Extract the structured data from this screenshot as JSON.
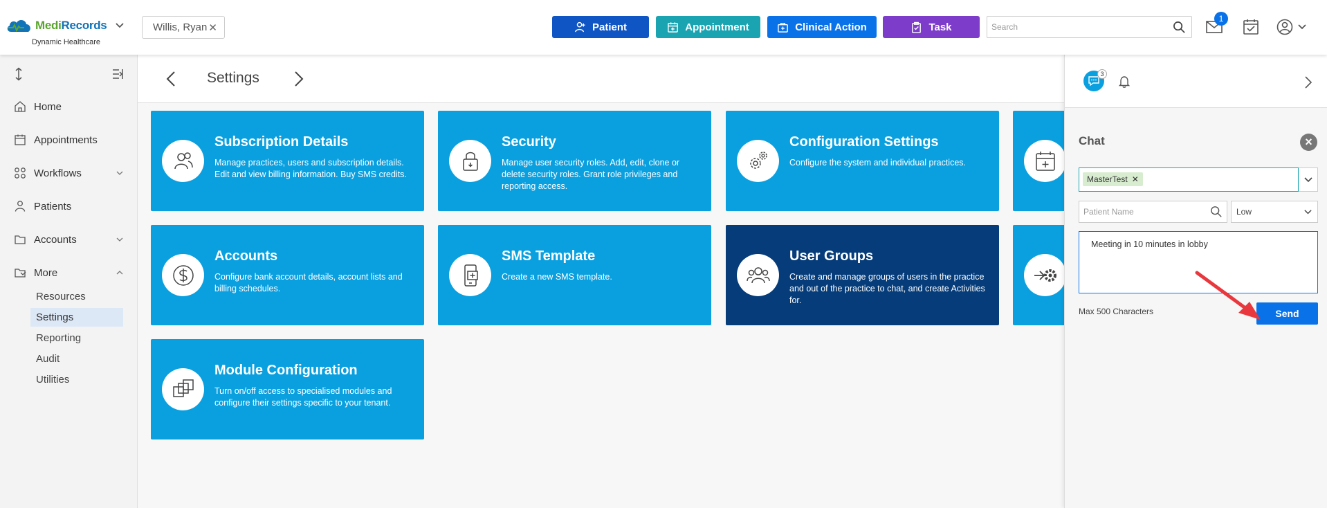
{
  "brand": {
    "name_part1": "Medi",
    "name_part2": "Records",
    "subtitle": "Dynamic Healthcare"
  },
  "header": {
    "patient_chip": "Willis, Ryan",
    "buttons": {
      "patient": "Patient",
      "appointment": "Appointment",
      "clinical_action": "Clinical Action",
      "task": "Task"
    },
    "button_colors": {
      "patient": "#0f56c4",
      "appointment": "#1aa4b2",
      "clinical_action": "#0a72e8",
      "task": "#7d3cc9"
    },
    "search_placeholder": "Search",
    "mail_badge": "1"
  },
  "sidebar": {
    "items": [
      {
        "label": "Home",
        "icon": "home-icon"
      },
      {
        "label": "Appointments",
        "icon": "calendar-icon"
      },
      {
        "label": "Workflows",
        "icon": "workflow-icon"
      },
      {
        "label": "Patients",
        "icon": "person-icon"
      },
      {
        "label": "Accounts",
        "icon": "folder-icon"
      },
      {
        "label": "More",
        "icon": "folder-open-icon"
      }
    ],
    "more_sub_items": [
      "Resources",
      "Settings",
      "Reporting",
      "Audit",
      "Utilities"
    ],
    "active_sub_item": "Settings"
  },
  "main": {
    "title": "Settings",
    "cards": [
      {
        "title": "Subscription Details",
        "description": "Manage practices, users and subscription details. Edit and view billing information. Buy SMS credits.",
        "icon": "users-icon"
      },
      {
        "title": "Security",
        "description": "Manage user security roles. Add, edit, clone or delete security roles. Grant role privileges and reporting access.",
        "icon": "lock-icon"
      },
      {
        "title": "Configuration Settings",
        "description": "Configure the system and individual practices.",
        "icon": "gears-icon"
      },
      {
        "title": "",
        "description": "",
        "icon": "calendar-plus-icon"
      },
      {
        "title": "Accounts",
        "description": "Configure bank account details, account lists and billing schedules.",
        "icon": "dollar-icon"
      },
      {
        "title": "SMS Template",
        "description": "Create a new SMS template.",
        "icon": "phone-plus-icon"
      },
      {
        "title": "User Groups",
        "description": "Create and manage groups of users in the practice and out of the practice to chat, and create Activities for.",
        "icon": "user-group-icon"
      },
      {
        "title": "",
        "description": "",
        "icon": "gear-arrow-icon"
      },
      {
        "title": "Module Configuration",
        "description": "Turn on/off access to specialised modules and configure their settings specific to your tenant.",
        "icon": "modules-icon"
      }
    ],
    "card_color": "#0aa0e0",
    "card_active_color": "#053c79"
  },
  "chat": {
    "badge": "3",
    "title": "Chat",
    "recipient_tag": "MasterTest",
    "patient_name_placeholder": "Patient Name",
    "priority": "Low",
    "message": "Meeting in 10 minutes in lobby",
    "max_chars": "Max 500 Characters",
    "send_label": "Send"
  }
}
